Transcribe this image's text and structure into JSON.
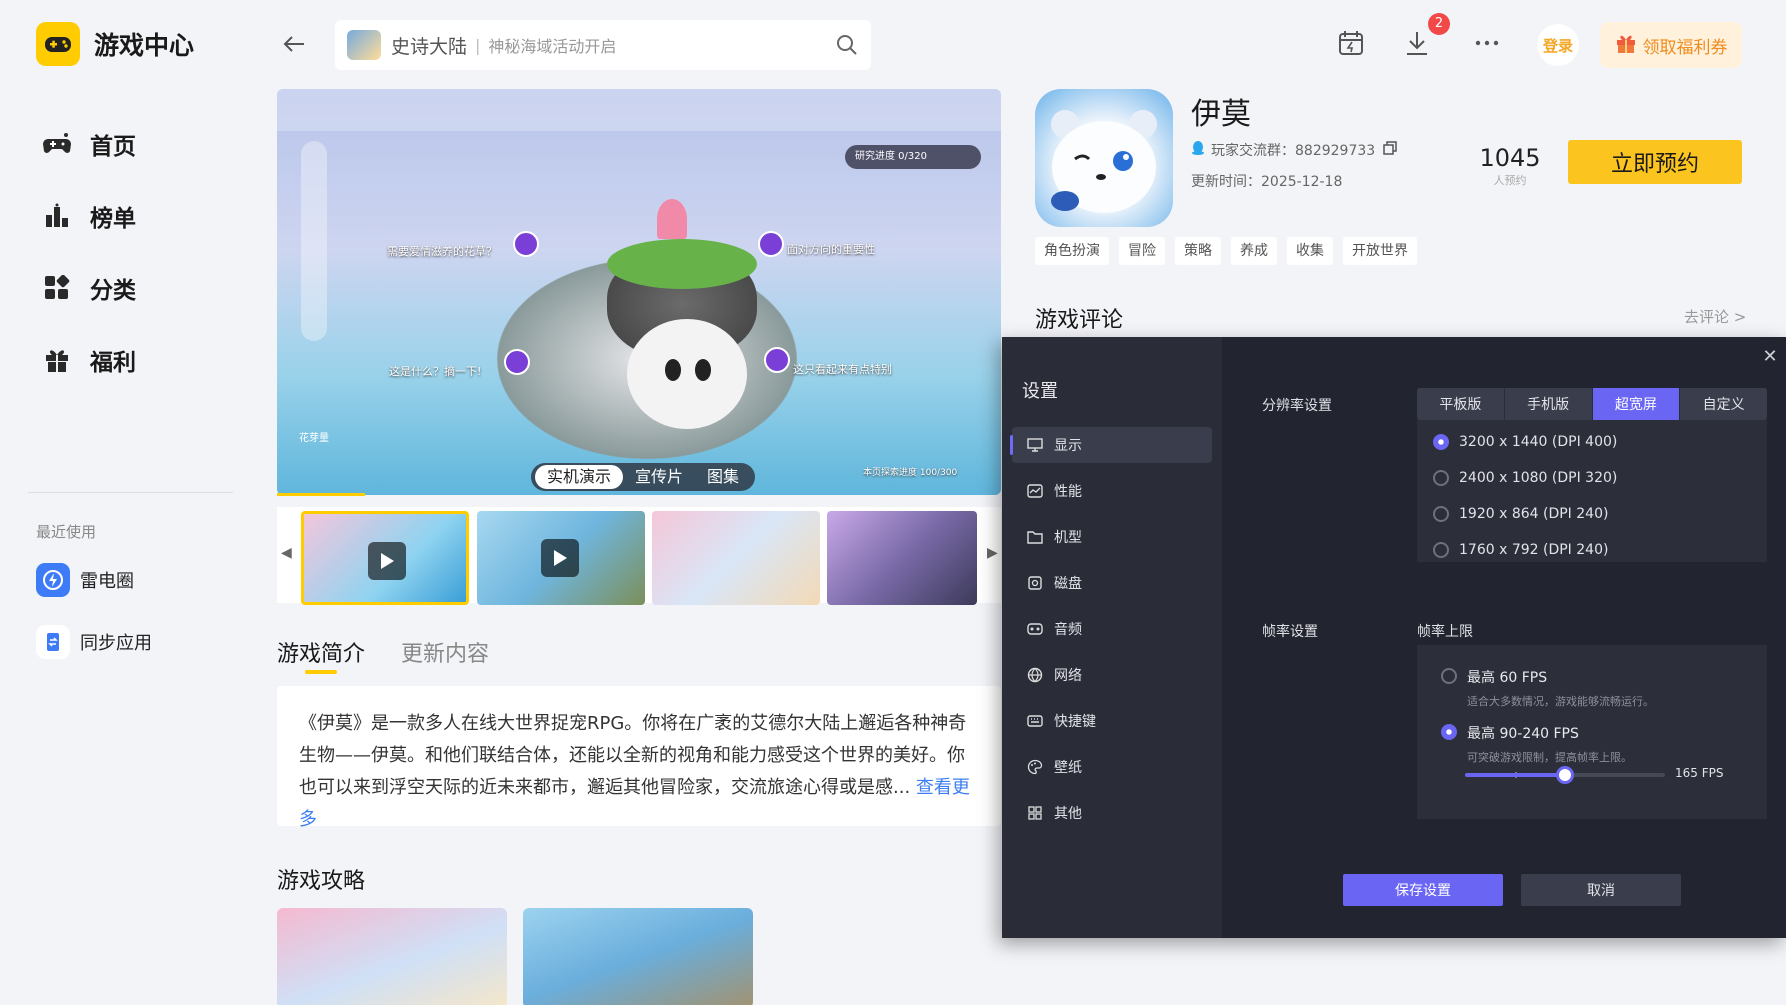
{
  "app": {
    "title": "游戏中心"
  },
  "sidebar": {
    "items": [
      {
        "label": "首页",
        "icon": "gamepad-icon"
      },
      {
        "label": "榜单",
        "icon": "ranking-icon"
      },
      {
        "label": "分类",
        "icon": "category-icon"
      },
      {
        "label": "福利",
        "icon": "gift-icon"
      }
    ],
    "recent_title": "最近使用",
    "recent": [
      {
        "label": "雷电圈",
        "icon": "leidian-circle-icon"
      },
      {
        "label": "同步应用",
        "icon": "sync-app-icon"
      }
    ]
  },
  "search": {
    "game_name": "史诗大陆",
    "separator": "|",
    "hint": "神秘海域活动开启"
  },
  "topbar": {
    "download_badge": "2",
    "login_label": "登录",
    "welfare_label": "领取福利券"
  },
  "media": {
    "tabs": [
      "实机演示",
      "宣传片",
      "图集"
    ],
    "active_tab": 0,
    "hud": {
      "quest": "研究进度  0/320",
      "bubble1": "需要爱情滋养的花草？",
      "bubble2": "面对方向的重要性",
      "bubble3": "这是什么？摘一下!",
      "bubble4": "这只看起来有点特别",
      "player_name": "花芽量",
      "footer": "本页探索进度  100/300"
    }
  },
  "intro": {
    "tabs": [
      "游戏简介",
      "更新内容"
    ],
    "text": "《伊莫》是一款多人在线大世界捉宠RPG。你将在广袤的艾德尔大陆上邂逅各种神奇生物——伊莫。和他们联结合体，还能以全新的视角和能力感受这个世界的美好。你也可以来到浮空天际的近未来都市，邂逅其他冒险家，交流旅途心得或是感...",
    "more": "查看更多"
  },
  "guides": {
    "title": "游戏攻略"
  },
  "game": {
    "name": "伊莫",
    "qq_group": "玩家交流群：882929733",
    "update_time": "更新时间：2025-12-18",
    "reserve_count": "1045",
    "reserve_unit": "人预约",
    "reserve_button": "立即预约",
    "tags": [
      "角色扮演",
      "冒险",
      "策略",
      "养成",
      "收集",
      "开放世界"
    ]
  },
  "reviews": {
    "title": "游戏评论",
    "link": "去评论 >"
  },
  "settings": {
    "title": "设置",
    "menu": [
      {
        "label": "显示",
        "icon": "monitor-icon"
      },
      {
        "label": "性能",
        "icon": "performance-icon"
      },
      {
        "label": "机型",
        "icon": "device-model-icon"
      },
      {
        "label": "磁盘",
        "icon": "disk-icon"
      },
      {
        "label": "音频",
        "icon": "audio-icon"
      },
      {
        "label": "网络",
        "icon": "network-icon"
      },
      {
        "label": "快捷键",
        "icon": "keyboard-icon"
      },
      {
        "label": "壁纸",
        "icon": "wallpaper-icon"
      },
      {
        "label": "其他",
        "icon": "other-icon"
      }
    ],
    "active_menu": 0,
    "resolution_label": "分辨率设置",
    "resolution_tabs": [
      "平板版",
      "手机版",
      "超宽屏",
      "自定义"
    ],
    "active_resolution_tab": 2,
    "resolutions": [
      "3200 x 1440  (DPI 400)",
      "2400 x 1080  (DPI 320)",
      "1920 x 864  (DPI 240)",
      "1760 x 792  (DPI 240)"
    ],
    "selected_resolution": 0,
    "fps_label": "帧率设置",
    "fps_limit_label": "帧率上限",
    "fps_options": [
      {
        "label": "最高 60 FPS",
        "desc": "适合大多数情况，游戏能够流畅运行。"
      },
      {
        "label": "最高 90-240 FPS",
        "desc": "可突破游戏限制，提高帧率上限。"
      }
    ],
    "selected_fps": 1,
    "fps_slider": {
      "value": 165,
      "min": 90,
      "max": 240,
      "label": "165 FPS"
    },
    "save_label": "保存设置",
    "cancel_label": "取消"
  },
  "colors": {
    "accent": "#FCC41F",
    "dialog_accent": "#6A66F3",
    "link": "#3D7FF0"
  }
}
